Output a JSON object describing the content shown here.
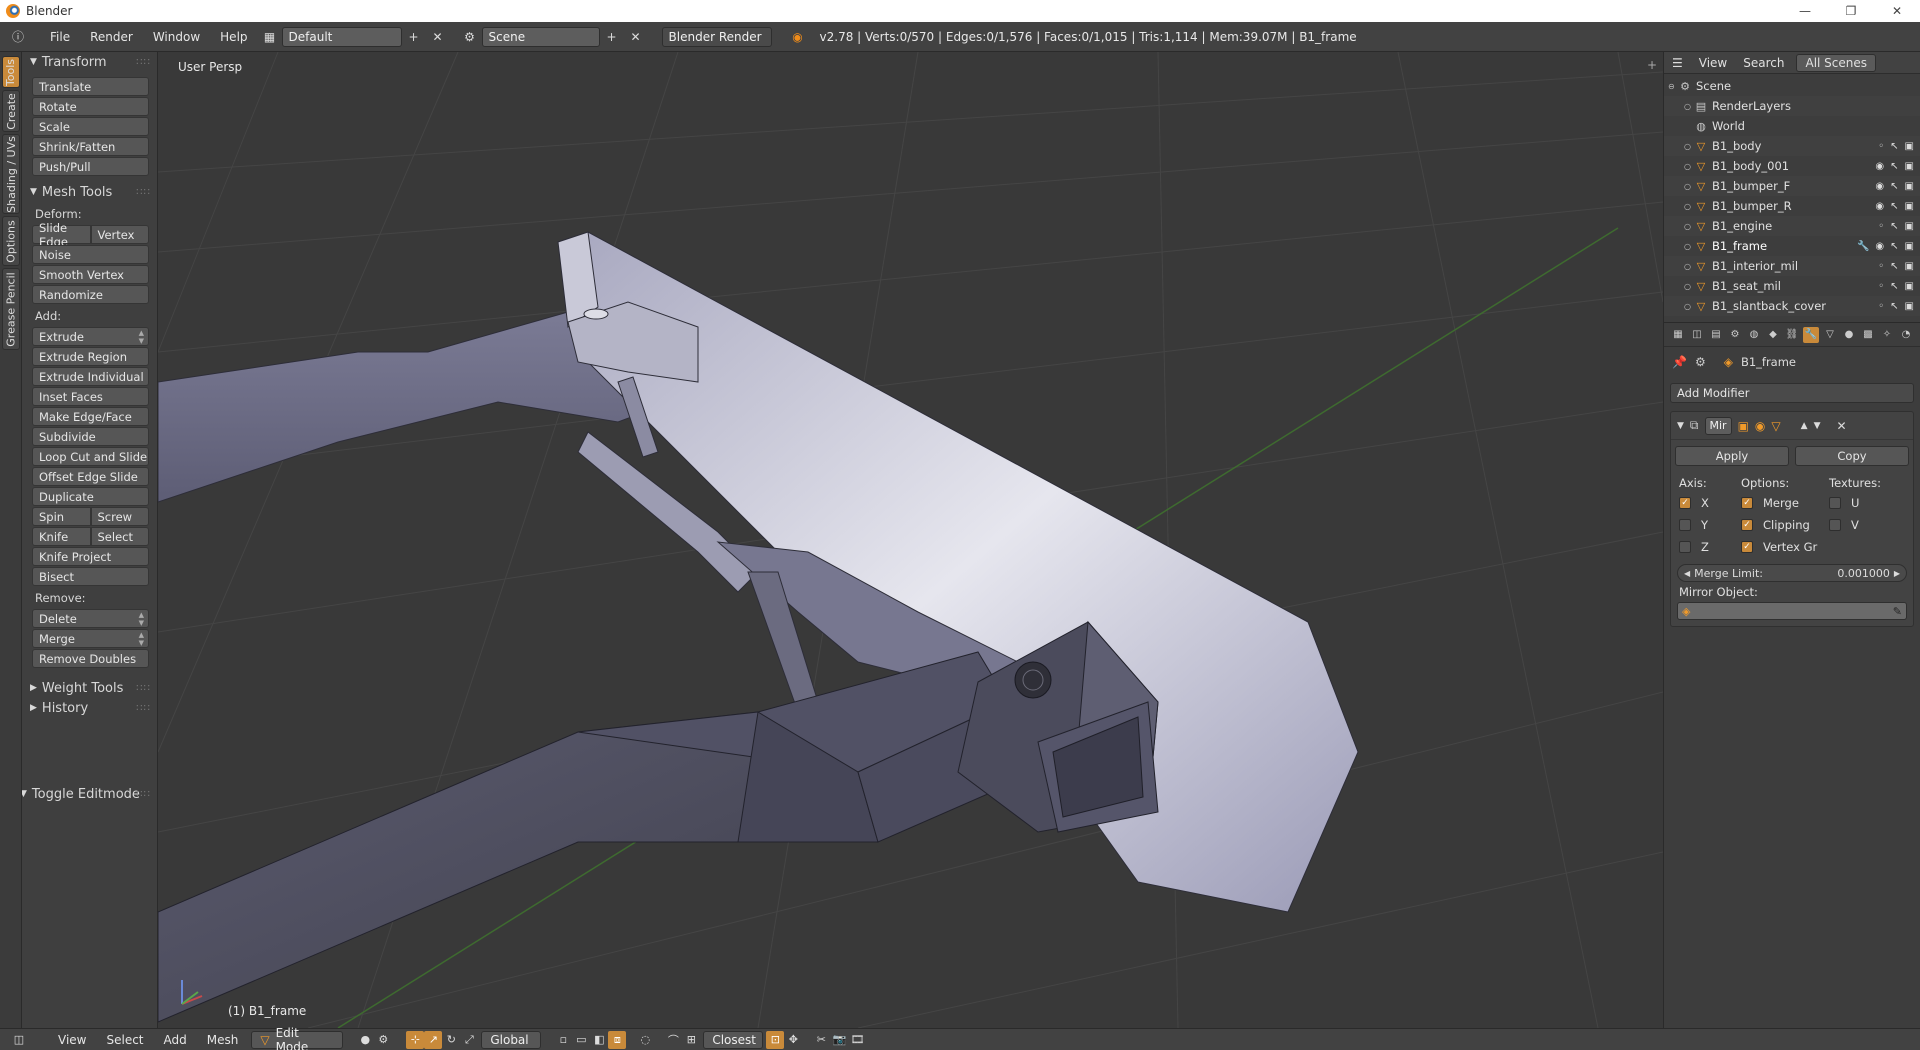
{
  "window": {
    "title": "Blender",
    "minimize": "—",
    "restore": "❐",
    "close": "✕"
  },
  "info_header": {
    "menus": [
      "File",
      "Render",
      "Window",
      "Help"
    ],
    "layout": "Default",
    "scene": "Scene",
    "engine": "Blender Render",
    "stats": "v2.78 | Verts:0/570 | Edges:0/1,576 | Faces:0/1,015 | Tris:1,114 | Mem:39.07M | B1_frame"
  },
  "left_tabs": [
    "Tools",
    "Create",
    "Shading / UVs",
    "Options",
    "Grease Pencil"
  ],
  "tool_shelf": {
    "transform": {
      "title": "Transform",
      "buttons": [
        "Translate",
        "Rotate",
        "Scale",
        "Shrink/Fatten",
        "Push/Pull"
      ]
    },
    "mesh_tools": {
      "title": "Mesh Tools",
      "deform_label": "Deform:",
      "slide_edge": "Slide Edge",
      "vertex": "Vertex",
      "deform_buttons": [
        "Noise",
        "Smooth Vertex",
        "Randomize"
      ],
      "add_label": "Add:",
      "extrude": "Extrude",
      "add_buttons": [
        "Extrude Region",
        "Extrude Individual",
        "Inset Faces",
        "Make Edge/Face",
        "Subdivide",
        "Loop Cut and Slide",
        "Offset Edge Slide",
        "Duplicate"
      ],
      "spin": "Spin",
      "screw": "Screw",
      "knife": "Knife",
      "select": "Select",
      "knife_project": "Knife Project",
      "bisect": "Bisect",
      "remove_label": "Remove:",
      "delete": "Delete",
      "merge": "Merge",
      "remove_doubles": "Remove Doubles"
    },
    "weight_tools": "Weight Tools",
    "history": "History",
    "toggle_editmode": "Toggle Editmode"
  },
  "viewport": {
    "view_label": "User Persp",
    "object_label": "(1) B1_frame"
  },
  "outliner": {
    "view": "View",
    "search": "Search",
    "filter": "All Scenes",
    "rows": [
      {
        "name": "Scene",
        "kind": "scene"
      },
      {
        "name": "RenderLayers",
        "kind": "renderlayers"
      },
      {
        "name": "World",
        "kind": "world"
      },
      {
        "name": "B1_body",
        "kind": "mesh"
      },
      {
        "name": "B1_body_001",
        "kind": "mesh"
      },
      {
        "name": "B1_bumper_F",
        "kind": "mesh"
      },
      {
        "name": "B1_bumper_R",
        "kind": "mesh"
      },
      {
        "name": "B1_engine",
        "kind": "mesh"
      },
      {
        "name": "B1_frame",
        "kind": "mesh"
      },
      {
        "name": "B1_interior_mil",
        "kind": "mesh"
      },
      {
        "name": "B1_seat_mil",
        "kind": "mesh"
      },
      {
        "name": "B1_slantback_cover",
        "kind": "mesh"
      }
    ]
  },
  "properties": {
    "object_name": "B1_frame",
    "add_modifier": "Add Modifier",
    "modifier_name": "Mir",
    "apply": "Apply",
    "copy": "Copy",
    "axis_label": "Axis:",
    "options_label": "Options:",
    "textures_label": "Textures:",
    "axis": [
      "X",
      "Y",
      "Z"
    ],
    "options": [
      "Merge",
      "Clipping",
      "Vertex Gr"
    ],
    "textures": [
      "U",
      "V"
    ],
    "merge_limit_label": "Merge Limit:",
    "merge_limit_value": "0.001000",
    "mirror_object_label": "Mirror Object:"
  },
  "bottom_header": {
    "menus": [
      "View",
      "Select",
      "Add",
      "Mesh"
    ],
    "mode": "Edit Mode",
    "orientation": "Global",
    "snap": "Closest"
  },
  "colors": {
    "accent": "#c98a3a",
    "background": "#393939",
    "panel": "#3f3f3f"
  }
}
